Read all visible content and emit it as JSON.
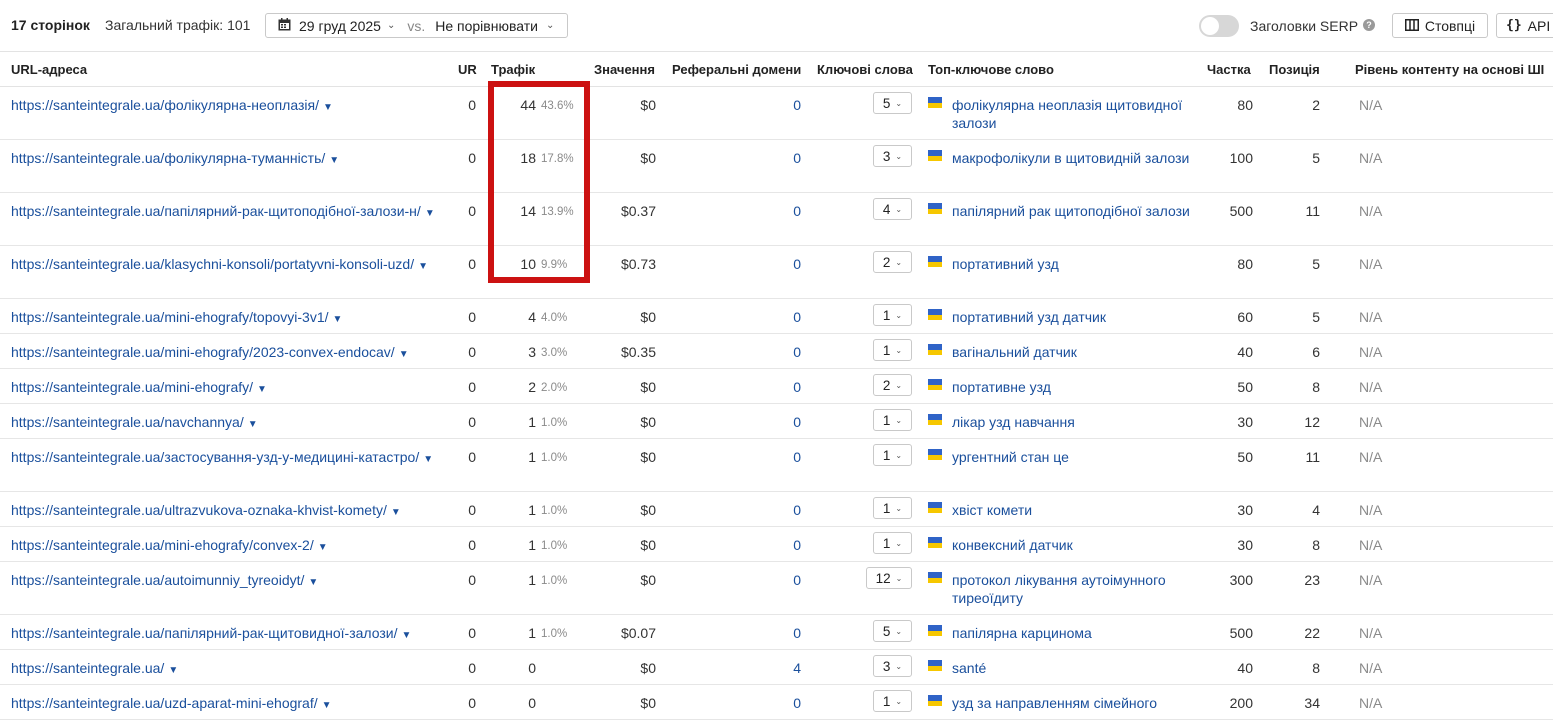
{
  "toolbar": {
    "pages_count": "17 сторінок",
    "total_traffic": "Загальний трафік: 101",
    "date": "29 груд 2025",
    "vs": "vs.",
    "compare": "Не порівнювати",
    "serp_label": "Заголовки SERP",
    "serp_toggle_on": false,
    "columns_label": "Стовпці",
    "api_label": "API"
  },
  "headers": {
    "url": "URL-адреса",
    "ur": "UR",
    "traffic": "Трафік",
    "value": "Значення",
    "ref_domains": "Реферальні домени",
    "keywords": "Ключові слова",
    "top_keyword": "Топ-ключове слово",
    "share": "Частка",
    "position": "Позиція",
    "ai_level": "Рівень контенту на основі ШІ"
  },
  "rows": [
    {
      "url": "https://santeintegrale.ua/фолікулярна-неоплазія/",
      "ur": "0",
      "traffic": "44",
      "pct": "43.6%",
      "value": "$0",
      "ref": "0",
      "kw": "5",
      "top_kw": "фолікулярна неоплазія щитовидної залози",
      "share": "80",
      "pos": "2",
      "ai": "N/A"
    },
    {
      "url": "https://santeintegrale.ua/фолікулярна-туманність/",
      "ur": "0",
      "traffic": "18",
      "pct": "17.8%",
      "value": "$0",
      "ref": "0",
      "kw": "3",
      "top_kw": "макрофолікули в щитовидній залози",
      "share": "100",
      "pos": "5",
      "ai": "N/A"
    },
    {
      "url": "https://santeintegrale.ua/папілярний-рак-щитоподібної-залози-н/",
      "ur": "0",
      "traffic": "14",
      "pct": "13.9%",
      "value": "$0.37",
      "ref": "0",
      "kw": "4",
      "top_kw": "папілярний рак щитоподібної залози",
      "share": "500",
      "pos": "11",
      "ai": "N/A"
    },
    {
      "url": "https://santeintegrale.ua/klasychni-konsoli/portatyvni-konsoli-uzd/",
      "ur": "0",
      "traffic": "10",
      "pct": "9.9%",
      "value": "$0.73",
      "ref": "0",
      "kw": "2",
      "top_kw": "портативний узд",
      "share": "80",
      "pos": "5",
      "ai": "N/A"
    },
    {
      "url": "https://santeintegrale.ua/mini-ehografy/topovyi-3v1/",
      "ur": "0",
      "traffic": "4",
      "pct": "4.0%",
      "value": "$0",
      "ref": "0",
      "kw": "1",
      "top_kw": "портативний узд датчик",
      "share": "60",
      "pos": "5",
      "ai": "N/A"
    },
    {
      "url": "https://santeintegrale.ua/mini-ehografy/2023-convex-endocav/",
      "ur": "0",
      "traffic": "3",
      "pct": "3.0%",
      "value": "$0.35",
      "ref": "0",
      "kw": "1",
      "top_kw": "вагінальний датчик",
      "share": "40",
      "pos": "6",
      "ai": "N/A"
    },
    {
      "url": "https://santeintegrale.ua/mini-ehografy/",
      "ur": "0",
      "traffic": "2",
      "pct": "2.0%",
      "value": "$0",
      "ref": "0",
      "kw": "2",
      "top_kw": "портативне узд",
      "share": "50",
      "pos": "8",
      "ai": "N/A"
    },
    {
      "url": "https://santeintegrale.ua/navchannya/",
      "ur": "0",
      "traffic": "1",
      "pct": "1.0%",
      "value": "$0",
      "ref": "0",
      "kw": "1",
      "top_kw": "лікар узд навчання",
      "share": "30",
      "pos": "12",
      "ai": "N/A"
    },
    {
      "url": "https://santeintegrale.ua/застосування-узд-у-медицині-катастро/",
      "ur": "0",
      "traffic": "1",
      "pct": "1.0%",
      "value": "$0",
      "ref": "0",
      "kw": "1",
      "top_kw": "ургентний стан це",
      "share": "50",
      "pos": "11",
      "ai": "N/A"
    },
    {
      "url": "https://santeintegrale.ua/ultrazvukova-oznaka-khvist-komety/",
      "ur": "0",
      "traffic": "1",
      "pct": "1.0%",
      "value": "$0",
      "ref": "0",
      "kw": "1",
      "top_kw": "хвіст комети",
      "share": "30",
      "pos": "4",
      "ai": "N/A"
    },
    {
      "url": "https://santeintegrale.ua/mini-ehografy/convex-2/",
      "ur": "0",
      "traffic": "1",
      "pct": "1.0%",
      "value": "$0",
      "ref": "0",
      "kw": "1",
      "top_kw": "конвексний датчик",
      "share": "30",
      "pos": "8",
      "ai": "N/A"
    },
    {
      "url": "https://santeintegrale.ua/autoimunniy_tyreoidyt/",
      "ur": "0",
      "traffic": "1",
      "pct": "1.0%",
      "value": "$0",
      "ref": "0",
      "kw": "12",
      "top_kw": "протокол лікування аутоімунного тиреоїдиту",
      "share": "300",
      "pos": "23",
      "ai": "N/A"
    },
    {
      "url": "https://santeintegrale.ua/папілярний-рак-щитовидної-залози/",
      "ur": "0",
      "traffic": "1",
      "pct": "1.0%",
      "value": "$0.07",
      "ref": "0",
      "kw": "5",
      "top_kw": "папілярна карцинома",
      "share": "500",
      "pos": "22",
      "ai": "N/A"
    },
    {
      "url": "https://santeintegrale.ua/",
      "ur": "0",
      "traffic": "0",
      "pct": "",
      "value": "$0",
      "ref": "4",
      "kw": "3",
      "top_kw": "santé",
      "share": "40",
      "pos": "8",
      "ai": "N/A"
    },
    {
      "url": "https://santeintegrale.ua/uzd-aparat-mini-ehograf/",
      "ur": "0",
      "traffic": "0",
      "pct": "",
      "value": "$0",
      "ref": "0",
      "kw": "1",
      "top_kw": "узд за направленням сімейного",
      "share": "200",
      "pos": "34",
      "ai": "N/A"
    }
  ]
}
